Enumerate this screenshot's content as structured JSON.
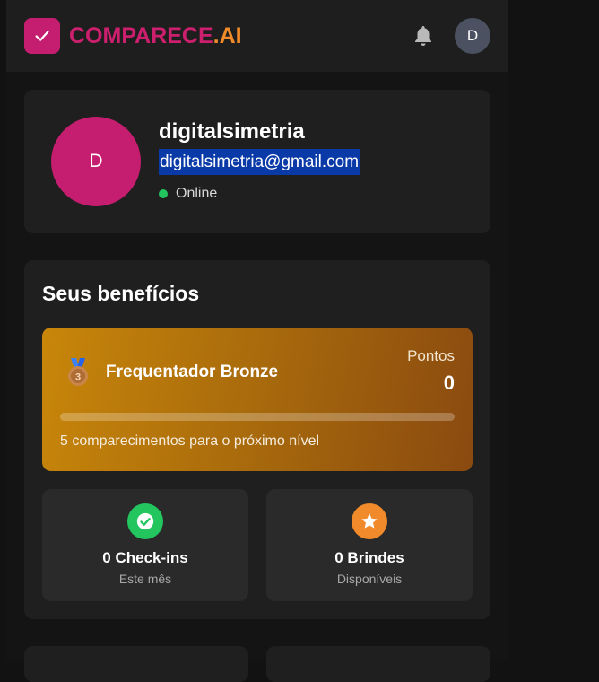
{
  "header": {
    "logo_brand": "COMPARECE",
    "logo_tld": ".AI",
    "avatar_initial": "D",
    "brand_color": "#c51d6f",
    "accent_color": "#f08a2a"
  },
  "profile": {
    "avatar_initial": "D",
    "username": "digitalsimetria",
    "email": "digitalsimetria@gmail.com",
    "status": "Online",
    "status_color": "#22c55e"
  },
  "benefits": {
    "title": "Seus benefícios",
    "tier": {
      "medal_icon": "bronze-medal-icon",
      "name": "Frequentador Bronze",
      "points_label": "Pontos",
      "points_value": "0",
      "progress_percent": 0,
      "next_level_text": "5 comparecimentos para o próximo nível"
    },
    "stats": [
      {
        "icon": "check-circle-icon",
        "value": "0 Check-ins",
        "sub": "Este mês",
        "color": "#22c55e"
      },
      {
        "icon": "star-icon",
        "value": "0 Brindes",
        "sub": "Disponíveis",
        "color": "#f08a2a"
      }
    ]
  }
}
